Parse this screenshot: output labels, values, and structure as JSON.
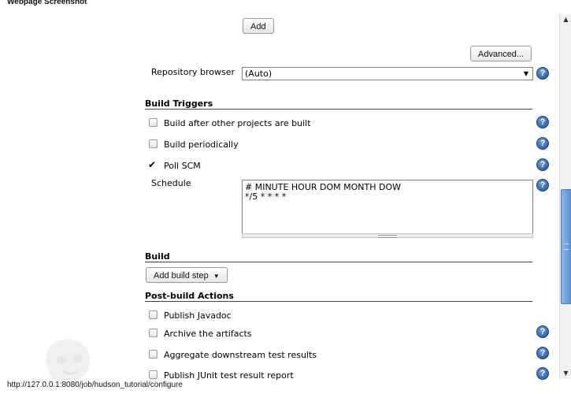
{
  "caption": "Webpage Screenshot",
  "buttons": {
    "add": "Add",
    "advanced": "Advanced...",
    "add_build_step": "Add build step"
  },
  "repository_browser": {
    "label": "Repository browser",
    "value": "(Auto)"
  },
  "build_triggers": {
    "title": "Build Triggers",
    "items": [
      {
        "label": "Build after other projects are built",
        "checked": false
      },
      {
        "label": "Build periodically",
        "checked": false
      },
      {
        "label": "Poll SCM",
        "checked": true
      }
    ],
    "schedule_label": "Schedule",
    "schedule_value": "# MINUTE HOUR DOM MONTH DOW\n*/5 * * * *"
  },
  "build": {
    "title": "Build"
  },
  "post_build": {
    "title": "Post-build Actions",
    "items": [
      {
        "label": "Publish Javadoc",
        "checked": false
      },
      {
        "label": "Archive the artifacts",
        "checked": false
      },
      {
        "label": "Aggregate downstream test results",
        "checked": false
      },
      {
        "label": "Publish JUnit test result report",
        "checked": false
      }
    ]
  },
  "help_icon_glyph": "?",
  "status_url": "http://127.0.0.1:8080/job/hudson_tutorial/configure",
  "colors": {
    "help_icon": "#2b5ba8",
    "scroll_thumb": "#6f9ad6"
  }
}
